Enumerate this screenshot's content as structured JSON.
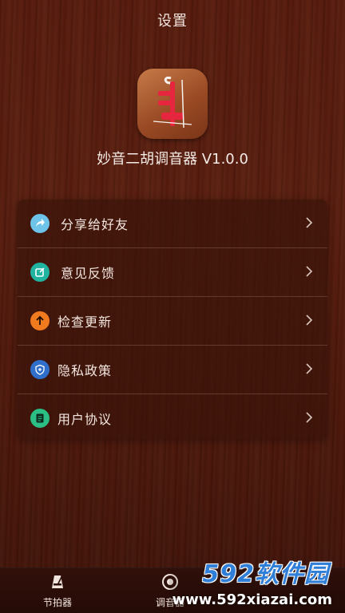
{
  "header": {
    "title": "设置"
  },
  "app": {
    "name": "妙音二胡调音器 V1.0.0",
    "icon": "erhu-app-icon"
  },
  "menu": {
    "items": [
      {
        "label": "分享给好友",
        "icon": "share-icon",
        "icon_color": "#6ec3e8"
      },
      {
        "label": "意见反馈",
        "icon": "edit-feedback-icon",
        "icon_color": "#1fb3a0"
      },
      {
        "label": "检查更新",
        "icon": "arrow-up-icon",
        "icon_color": "#f07a1e"
      },
      {
        "label": "隐私政策",
        "icon": "shield-icon",
        "icon_color": "#2f6fc9"
      },
      {
        "label": "用户协议",
        "icon": "document-icon",
        "icon_color": "#2bbf86"
      }
    ]
  },
  "tabbar": {
    "tabs": [
      {
        "label": "节拍器",
        "icon": "metronome-icon"
      },
      {
        "label": "调音器",
        "icon": "tuner-icon"
      }
    ]
  },
  "watermark": {
    "logo": "592软件园",
    "url": "www.592xiazai.com"
  },
  "colors": {
    "accent_panel": "#3a140a",
    "text": "#f4e7e0"
  }
}
